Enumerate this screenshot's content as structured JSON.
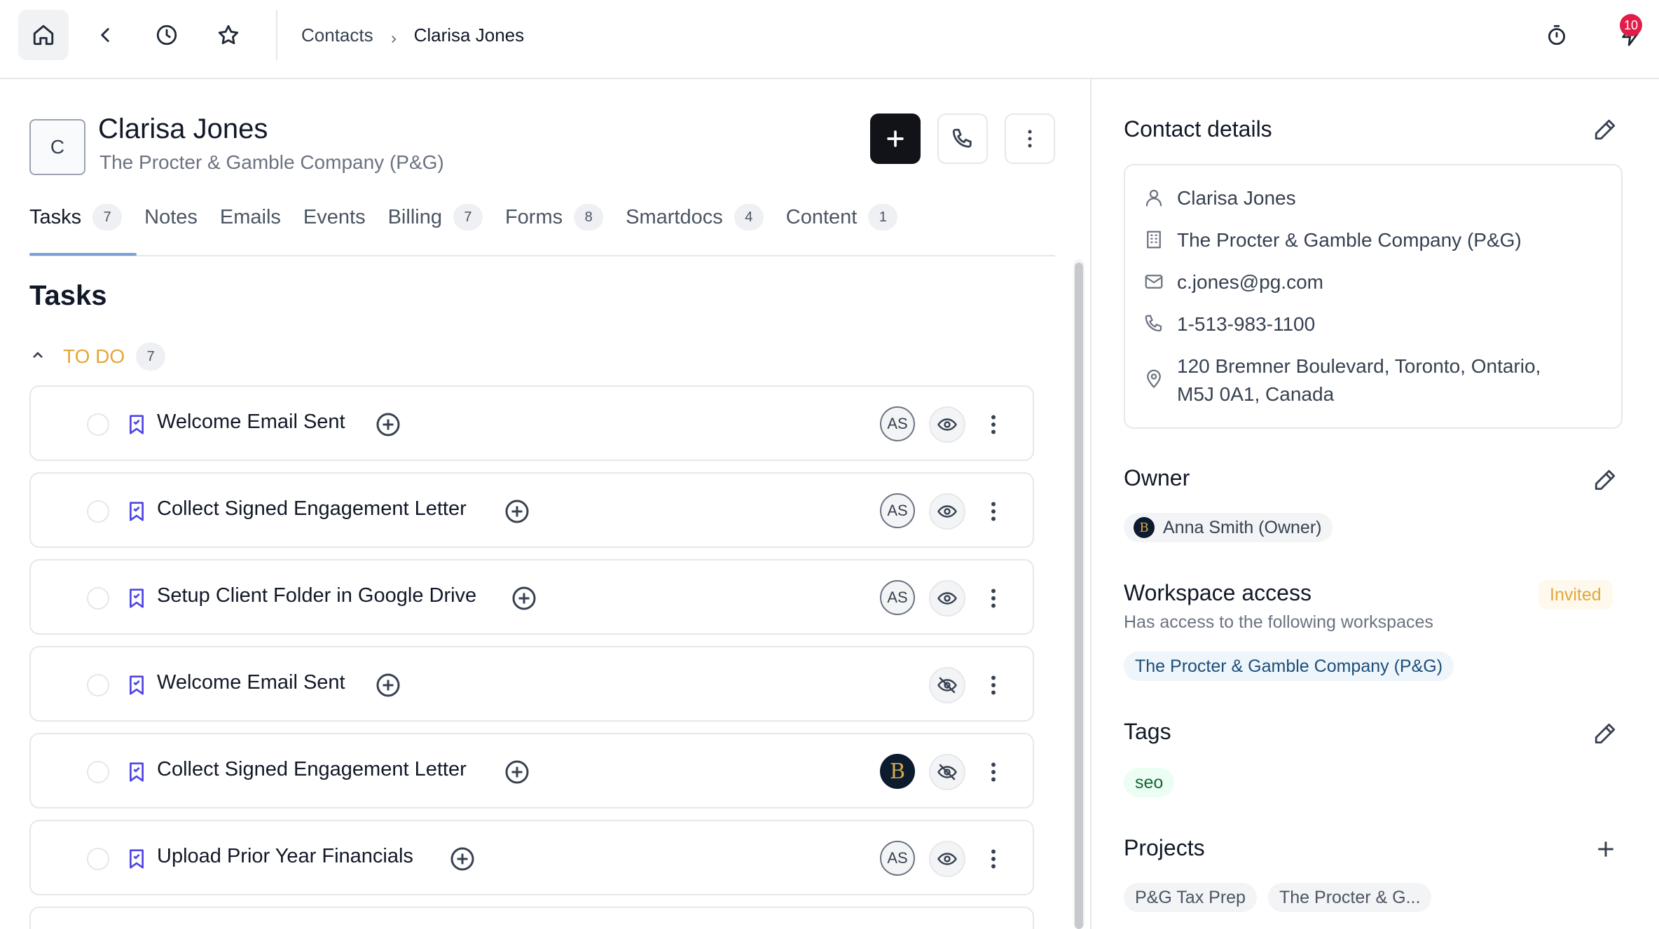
{
  "breadcrumb": {
    "parent": "Contacts",
    "current": "Clarisa Jones"
  },
  "notifications": {
    "count": "10"
  },
  "contact": {
    "initial": "C",
    "name": "Clarisa Jones",
    "company": "The Procter & Gamble Company (P&G)"
  },
  "tabs": [
    {
      "label": "Tasks",
      "count": "7"
    },
    {
      "label": "Notes"
    },
    {
      "label": "Emails"
    },
    {
      "label": "Events"
    },
    {
      "label": "Billing",
      "count": "7"
    },
    {
      "label": "Forms",
      "count": "8"
    },
    {
      "label": "Smartdocs",
      "count": "4"
    },
    {
      "label": "Content",
      "count": "1"
    }
  ],
  "tasks_section": {
    "title": "Tasks",
    "group": {
      "label": "TO DO",
      "count": "7"
    },
    "items": [
      {
        "title": "Welcome Email Sent",
        "assignee": "AS",
        "visible": true
      },
      {
        "title": "Collect Signed Engagement Letter",
        "assignee": "AS",
        "visible": true
      },
      {
        "title": "Setup Client Folder in Google Drive",
        "assignee": "AS",
        "visible": true
      },
      {
        "title": "Welcome Email Sent",
        "assignee": "",
        "visible": false
      },
      {
        "title": "Collect Signed Engagement Letter",
        "assignee": "B",
        "visible": false
      },
      {
        "title": "Upload Prior Year Financials",
        "assignee": "AS",
        "visible": true
      }
    ]
  },
  "contact_details": {
    "title": "Contact details",
    "name": "Clarisa Jones",
    "company": "The Procter & Gamble Company (P&G)",
    "email": "c.jones@pg.com",
    "phone": "1-513-983-1100",
    "address_line1": "120 Bremner Boulevard, Toronto, Ontario,",
    "address_line2": "M5J 0A1, Canada"
  },
  "owner": {
    "title": "Owner",
    "logo_letter": "B",
    "name": "Anna Smith (Owner)"
  },
  "workspace": {
    "title": "Workspace access",
    "status": "Invited",
    "subtitle": "Has access to the following workspaces",
    "item": "The Procter & Gamble Company (P&G)"
  },
  "tags": {
    "title": "Tags",
    "items": [
      "seo"
    ]
  },
  "projects": {
    "title": "Projects",
    "items": [
      "P&G Tax Prep",
      "The Procter & G..."
    ]
  },
  "colors": {
    "accent": "#4f46e5",
    "todo": "#e3a73a",
    "badge": "#e11d48",
    "primary_button": "#111318"
  }
}
